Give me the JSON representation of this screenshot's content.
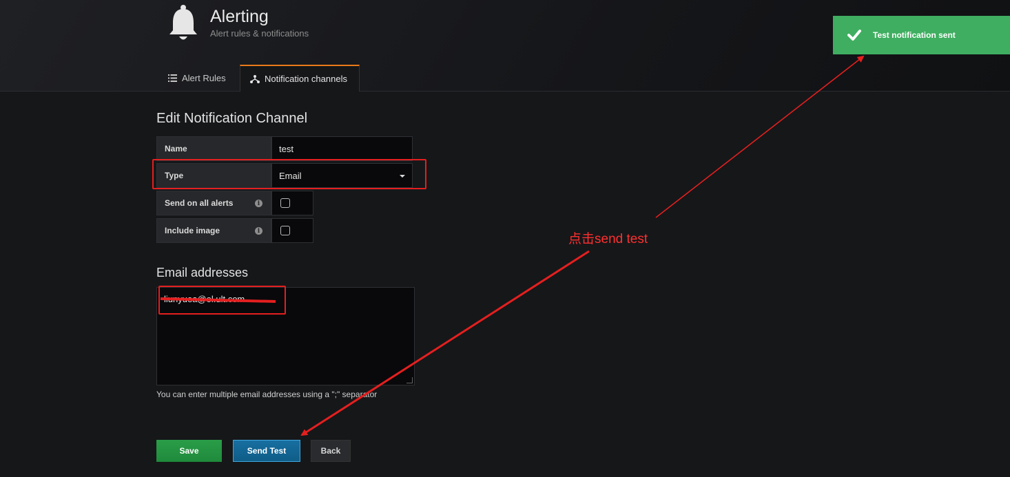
{
  "header": {
    "title": "Alerting",
    "subtitle": "Alert rules & notifications",
    "icon": "bell-icon",
    "tabs": [
      {
        "label": "Alert Rules",
        "icon": "list-icon"
      },
      {
        "label": "Notification channels",
        "icon": "sitemap-icon",
        "active": true
      }
    ]
  },
  "form": {
    "title": "Edit Notification Channel",
    "name_label": "Name",
    "name_value": "test",
    "type_label": "Type",
    "type_value": "Email",
    "send_all_label": "Send on all alerts",
    "send_all_checked": false,
    "include_image_label": "Include image",
    "include_image_checked": false,
    "info_glyph": "i"
  },
  "email": {
    "title": "Email addresses",
    "value": "liunyuea@ol.ult.com",
    "help": "You can enter multiple email addresses using a \";\" separator"
  },
  "buttons": {
    "save": "Save",
    "send_test": "Send Test",
    "back": "Back"
  },
  "toast": {
    "message": "Test notification sent",
    "color": "#3fae60"
  },
  "annotation": {
    "text": "点击send test",
    "color": "#e51f1f"
  }
}
